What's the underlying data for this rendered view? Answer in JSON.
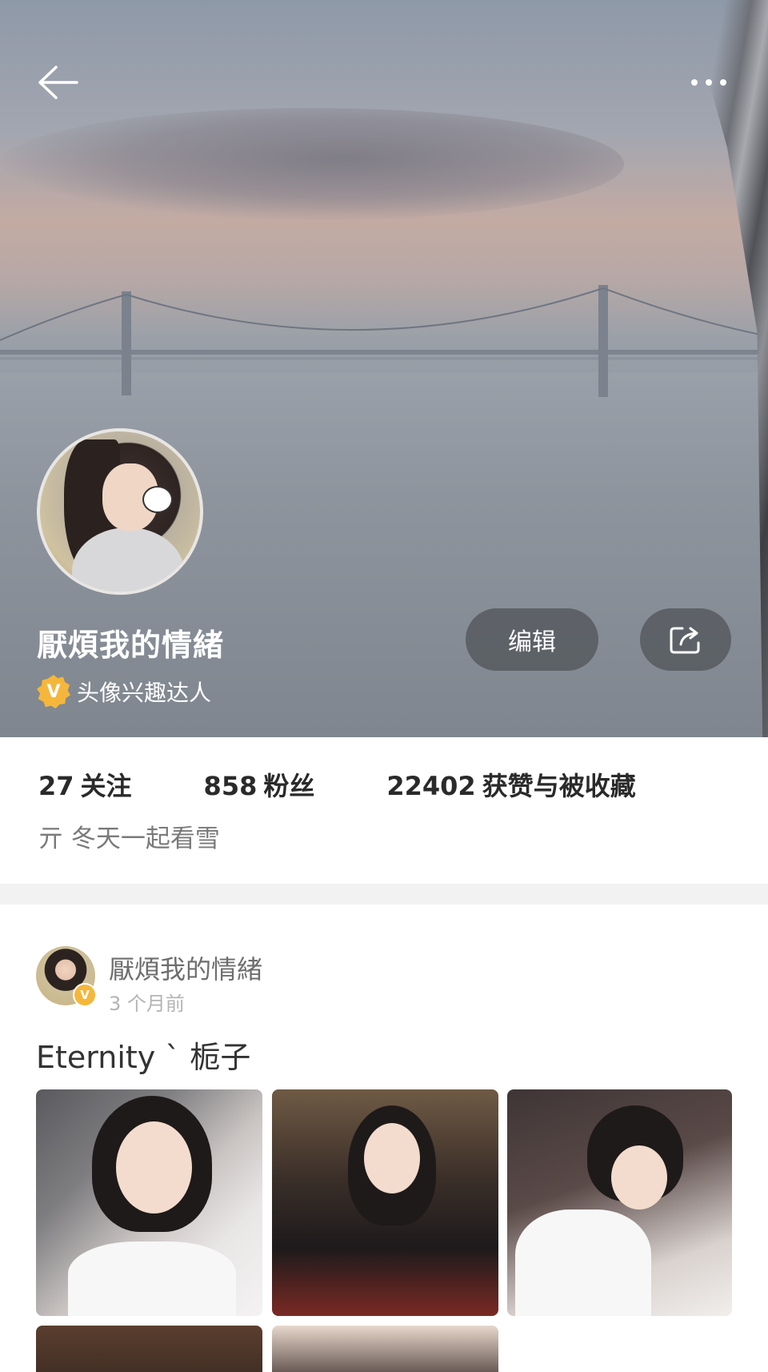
{
  "header": {
    "back_icon": "arrow-left-icon",
    "more_icon": "more-dots-icon"
  },
  "profile": {
    "name": "厭煩我的情緒",
    "badge_icon": "verified-v-badge-icon",
    "badge_label": "头像兴趣达人",
    "edit_label": "编辑",
    "share_icon": "share-icon",
    "avatar_icon": "user-avatar"
  },
  "stats": {
    "following_count": "27",
    "following_label": "关注",
    "fans_count": "858",
    "fans_label": "粉丝",
    "likes_count": "22402",
    "likes_label": "获赞与被收藏"
  },
  "bio": "亓 冬天一起看雪",
  "post": {
    "author": "厭煩我的情緒",
    "time": "3 个月前",
    "text": "Eternity ` 栀子",
    "badge_letter": "V",
    "images": [
      "photo-1",
      "photo-2",
      "photo-3",
      "photo-4",
      "photo-5"
    ]
  },
  "colors": {
    "badge": "#f5b73b",
    "divider": "#f2f2f2",
    "muted_text": "#7a7a7a"
  }
}
